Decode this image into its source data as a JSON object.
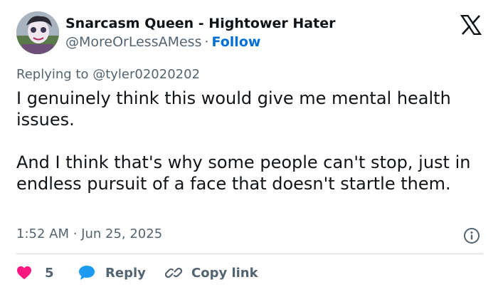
{
  "author": {
    "display_name": "Snarcasm Queen - Hightower Hater",
    "handle": "@MoreOrLessAMess",
    "separator": "·",
    "follow_label": "Follow"
  },
  "reply_context": {
    "prefix": "Replying to",
    "mention": "@tyler02020202"
  },
  "tweet": {
    "paragraphs": [
      "I genuinely think this would give me mental health issues.",
      "And I think that's why some people can't stop, just in endless pursuit of a face that doesn't startle them."
    ],
    "timestamp": "1:52 AM · Jun 25, 2025"
  },
  "actions": {
    "like_count": "5",
    "reply_label": "Reply",
    "copy_label": "Copy link"
  },
  "icons": {
    "logo": "x-logo-icon",
    "info": "info-icon",
    "like": "heart-icon",
    "reply": "speech-bubble-icon",
    "copy": "link-icon"
  },
  "colors": {
    "follow": "#006fd6",
    "secondary_text": "#536471",
    "heart": "#f91880",
    "reply_bubble": "#1d9bf0",
    "divider": "#cfd9de"
  }
}
